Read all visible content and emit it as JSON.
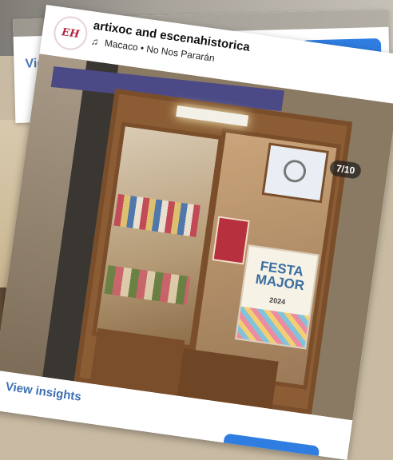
{
  "post": {
    "username": "artixoc and escenahistorica",
    "music": "Macaco • No Nos Pararán",
    "avatar_text": "EH",
    "page_counter": "7/10",
    "footer_link": "View insights"
  },
  "back_card": {
    "footer_link": "View in"
  },
  "poster": {
    "title": "FESTA MAJOR",
    "year": "2024"
  },
  "icons": {
    "music": "music-note-icon",
    "mute": "speaker-muted-icon"
  },
  "colors": {
    "link": "#3c6fb2",
    "primary_button": "#2f7de1"
  }
}
